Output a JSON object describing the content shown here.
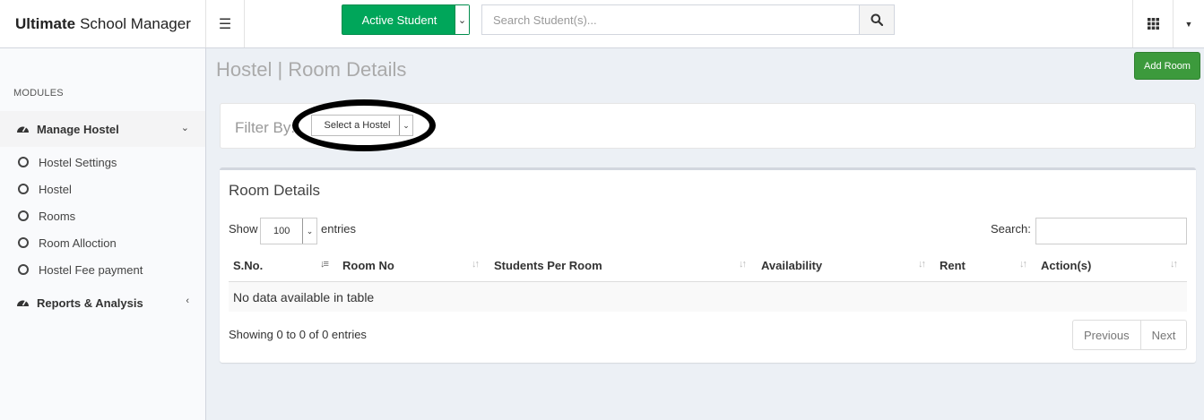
{
  "header": {
    "brand_bold": "Ultimate",
    "brand_rest": "School Manager",
    "student_status_selected": "Active Student",
    "search_placeholder": "Search Student(s)..."
  },
  "sidebar": {
    "section_label": "MODULES",
    "manage_hostel": "Manage Hostel",
    "sub_items": [
      "Hostel Settings",
      "Hostel",
      "Rooms",
      "Room Alloction",
      "Hostel Fee payment"
    ],
    "reports": "Reports & Analysis"
  },
  "page": {
    "title": "Hostel | Room Details",
    "add_button": "Add Room",
    "filter_label": "Filter By:",
    "hostel_select": "Select a Hostel"
  },
  "table_box": {
    "title": "Room Details",
    "show_label": "Show",
    "entries_value": "100",
    "entries_label": "entries",
    "search_label": "Search:",
    "columns": [
      "S.No.",
      "Room No",
      "Students Per Room",
      "Availability",
      "Rent",
      "Action(s)"
    ],
    "empty_message": "No data available in table",
    "info": "Showing 0 to 0 of 0 entries",
    "prev_label": "Previous",
    "next_label": "Next"
  },
  "colors": {
    "active_green": "#00a65a",
    "add_room_green": "#3c9a3c",
    "content_bg": "#ecf0f5"
  },
  "icons": [
    "menu-icon",
    "caret-down-icon",
    "search-icon",
    "apps-grid-icon",
    "dashboard-icon",
    "chevron-down-icon",
    "circle-icon",
    "chevron-left-icon",
    "sort-icon"
  ]
}
